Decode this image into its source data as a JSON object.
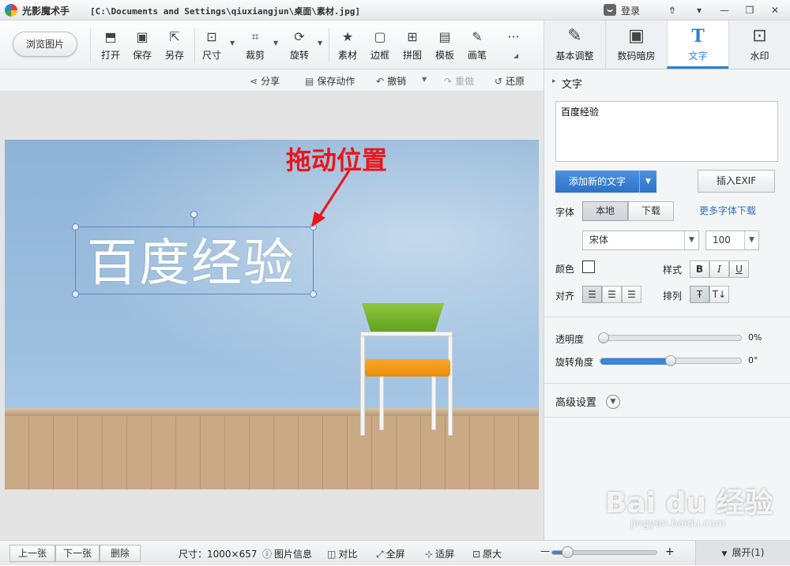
{
  "titlebar": {
    "app_name": "光影魔术手",
    "file_path": "[C:\\Documents and Settings\\qiuxiangjun\\桌面\\素材.jpg]",
    "login_label": "登录",
    "controls": [
      "⇮",
      "▾",
      "—",
      "❐",
      "✕"
    ]
  },
  "ribbon": {
    "browse_label": "浏览图片",
    "tools": [
      {
        "label": "打开",
        "icon": "open-icon"
      },
      {
        "label": "保存",
        "icon": "save-icon"
      },
      {
        "label": "另存",
        "icon": "save-as-icon"
      },
      {
        "label": "尺寸",
        "icon": "resize-icon"
      },
      {
        "label": "裁剪",
        "icon": "crop-icon"
      },
      {
        "label": "旋转",
        "icon": "rotate-icon"
      },
      {
        "label": "素材",
        "icon": "sticker-icon"
      },
      {
        "label": "边框",
        "icon": "border-icon"
      },
      {
        "label": "拼图",
        "icon": "collage-icon"
      },
      {
        "label": "模板",
        "icon": "template-icon"
      },
      {
        "label": "画笔",
        "icon": "brush-icon"
      },
      {
        "label": "···",
        "icon": "more-icon"
      }
    ]
  },
  "right_tabs": [
    {
      "label": "基本调整",
      "icon": "adjust-icon",
      "active": false
    },
    {
      "label": "数码暗房",
      "icon": "darkroom-icon",
      "active": false
    },
    {
      "label": "文字",
      "icon": "text-tool-icon",
      "active": true
    },
    {
      "label": "水印",
      "icon": "watermark-icon",
      "active": false
    }
  ],
  "subbar": {
    "share": "分享",
    "save_action": "保存动作",
    "undo": "撤销",
    "redo": "重做",
    "restore": "还原"
  },
  "canvas": {
    "overlay_text": "百度经验",
    "annotation": "拖动位置"
  },
  "panel": {
    "section_title": "文字",
    "text_value": "百度经验",
    "add_text_label": "添加新的文字",
    "insert_exif_label": "插入EXIF",
    "font_label": "字体",
    "font_source_local": "本地",
    "font_source_download": "下载",
    "more_fonts_link": "更多字体下载",
    "font_name": "宋体",
    "font_size": "100",
    "color_label": "颜色",
    "style_label": "样式",
    "bold": "B",
    "italic": "I",
    "underline": "U",
    "align_label": "对齐",
    "arrange_label": "排列",
    "opacity_label": "透明度",
    "opacity_value": "0%",
    "opacity_fraction": 0,
    "rotation_label": "旋转角度",
    "rotation_value": "0°",
    "rotation_fraction": 0.5,
    "advanced_label": "高级设置",
    "text_color": "#ffffff"
  },
  "status": {
    "prev": "上一张",
    "next": "下一张",
    "delete": "删除",
    "size": "尺寸：1000×657",
    "image_info": "图片信息",
    "compare": "对比",
    "fullscreen": "全屏",
    "fit": "适屏",
    "original": "原大",
    "zoom_minus": "—",
    "zoom_plus": "+",
    "zoom_fraction": 0.15,
    "expand": "展开(1)"
  },
  "watermark": {
    "brand": "Bai du 经验",
    "url": "jingyan.baidu.com"
  },
  "colors": {
    "accent": "#2f7fd6",
    "annotation_red": "#e8161c",
    "add_button": "#3a80d4"
  }
}
